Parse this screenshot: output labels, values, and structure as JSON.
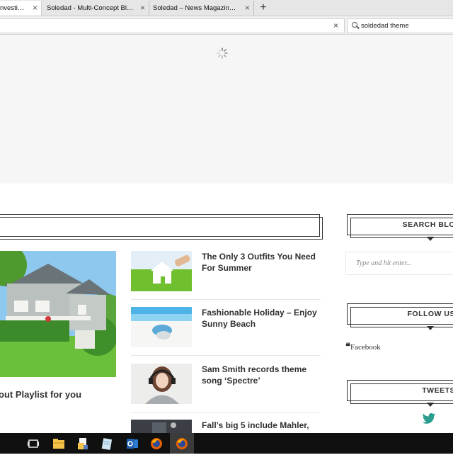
{
  "browser": {
    "tabs": [
      {
        "label": "nvesting..."
      },
      {
        "label": "Soledad - Multi-Concept Blog..."
      },
      {
        "label": "Soledad – News Magazine Wo..."
      }
    ],
    "new_tab_label": "+",
    "close_glyph": "×",
    "search_query": "soldedad theme",
    "icons": [
      "close-icon",
      "plus-icon",
      "search-icon",
      "clear-icon"
    ]
  },
  "posts": {
    "featured_title": "out Playlist for you",
    "list": [
      {
        "title": "The Only 3 Outfits You Need For Summer"
      },
      {
        "title": "Fashionable Holiday – Enjoy Sunny Beach"
      },
      {
        "title": "Sam Smith records theme song ‘Spectre’"
      },
      {
        "title": "Fall’s big 5 include Mahler,"
      }
    ]
  },
  "sidebar": {
    "search_title": "SEARCH BLO",
    "search_placeholder": "Type and hit enter...",
    "follow_title": "FOLLOW US",
    "facebook_quote": "❝",
    "facebook_label": "Facebook",
    "tweets_title": "TWEETS"
  },
  "taskbar": {
    "items": [
      "task-view-icon",
      "file-explorer-icon",
      "file-manager-icon",
      "notepad-icon",
      "outlook-icon",
      "firefox-icon",
      "firefox-active-icon"
    ]
  },
  "colors": {
    "text": "#313131",
    "twitter": "#2a9d8f",
    "taskbar": "#101010"
  }
}
